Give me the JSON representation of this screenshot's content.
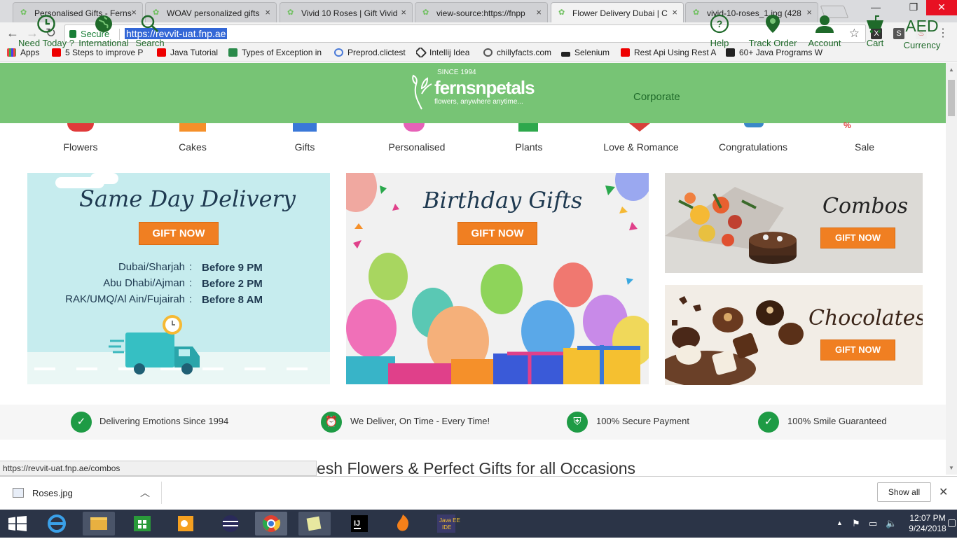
{
  "browser": {
    "tabs": [
      {
        "title": "Personalised Gifts - Ferns"
      },
      {
        "title": "WOAV personalized gifts"
      },
      {
        "title": "Vivid 10 Roses | Gift Vivid"
      },
      {
        "title": "view-source:https://fnpp"
      },
      {
        "title": "Flower Delivery Dubai | C"
      },
      {
        "title": "vivid-10-roses_1.jpg (428"
      }
    ],
    "secure_label": "Secure",
    "url": "https://revvit-uat.fnp.ae",
    "bookmarks": [
      "Apps",
      "5 Steps to improve P",
      "Java Tutorial",
      "Types of Exception in",
      "Preprod.clictest",
      "Intellij Idea",
      "chillyfacts.com",
      "Selenium",
      "Rest Api Using Rest A",
      "60+ Java Programs W"
    ]
  },
  "site": {
    "header_left": [
      {
        "label": "Need Today ?",
        "icon": "clock-icon"
      },
      {
        "label": "International",
        "icon": "globe-icon"
      },
      {
        "label": "Search",
        "icon": "search-icon"
      }
    ],
    "logo": {
      "since": "SINCE 1994",
      "name": "fernsnpetals",
      "tagline": "flowers, anywhere anytime..."
    },
    "corporate": "Corporate",
    "header_right": [
      {
        "label": "Help",
        "icon": "help-icon"
      },
      {
        "label": "Track Order",
        "icon": "location-pin-icon"
      },
      {
        "label": "Account",
        "icon": "user-icon"
      },
      {
        "label": "Cart",
        "icon": "cart-icon"
      },
      {
        "label": "Currency",
        "value": "AED"
      }
    ],
    "categories": [
      "Flowers",
      "Cakes",
      "Gifts",
      "Personalised",
      "Plants",
      "Love & Romance",
      "Congratulations",
      "Sale"
    ],
    "banners": {
      "same_day": {
        "title": "Same Day Delivery",
        "button": "GIFT NOW",
        "rows": [
          {
            "place": "Dubai/Sharjah",
            "time": "Before 9 PM"
          },
          {
            "place": "Abu Dhabi/Ajman",
            "time": "Before 2 PM"
          },
          {
            "place": "RAK/UMQ/Al Ain/Fujairah",
            "time": "Before 8 AM"
          }
        ]
      },
      "birthday": {
        "title": "Birthday Gifts",
        "button": "GIFT NOW"
      },
      "combos": {
        "title": "Combos",
        "button": "GIFT NOW"
      },
      "chocolates": {
        "title": "Chocolates",
        "button": "GIFT NOW"
      }
    },
    "trust": [
      {
        "label": "Delivering Emotions Since 1994"
      },
      {
        "label": "We Deliver, On Time - Every Time!"
      },
      {
        "label": "100% Secure Payment"
      },
      {
        "label": "100% Smile Guaranteed"
      }
    ],
    "heading": "esh Flowers & Perfect Gifts for all Occasions",
    "status_url": "https://revvit-uat.fnp.ae/combos"
  },
  "downloads": {
    "file": "Roses.jpg",
    "show_all": "Show all"
  },
  "taskbar": {
    "time": "12:07 PM",
    "date": "9/24/2018"
  },
  "colors": {
    "header_green": "#77c475",
    "accent_orange": "#f07f22",
    "trust_green": "#1e9b45"
  }
}
